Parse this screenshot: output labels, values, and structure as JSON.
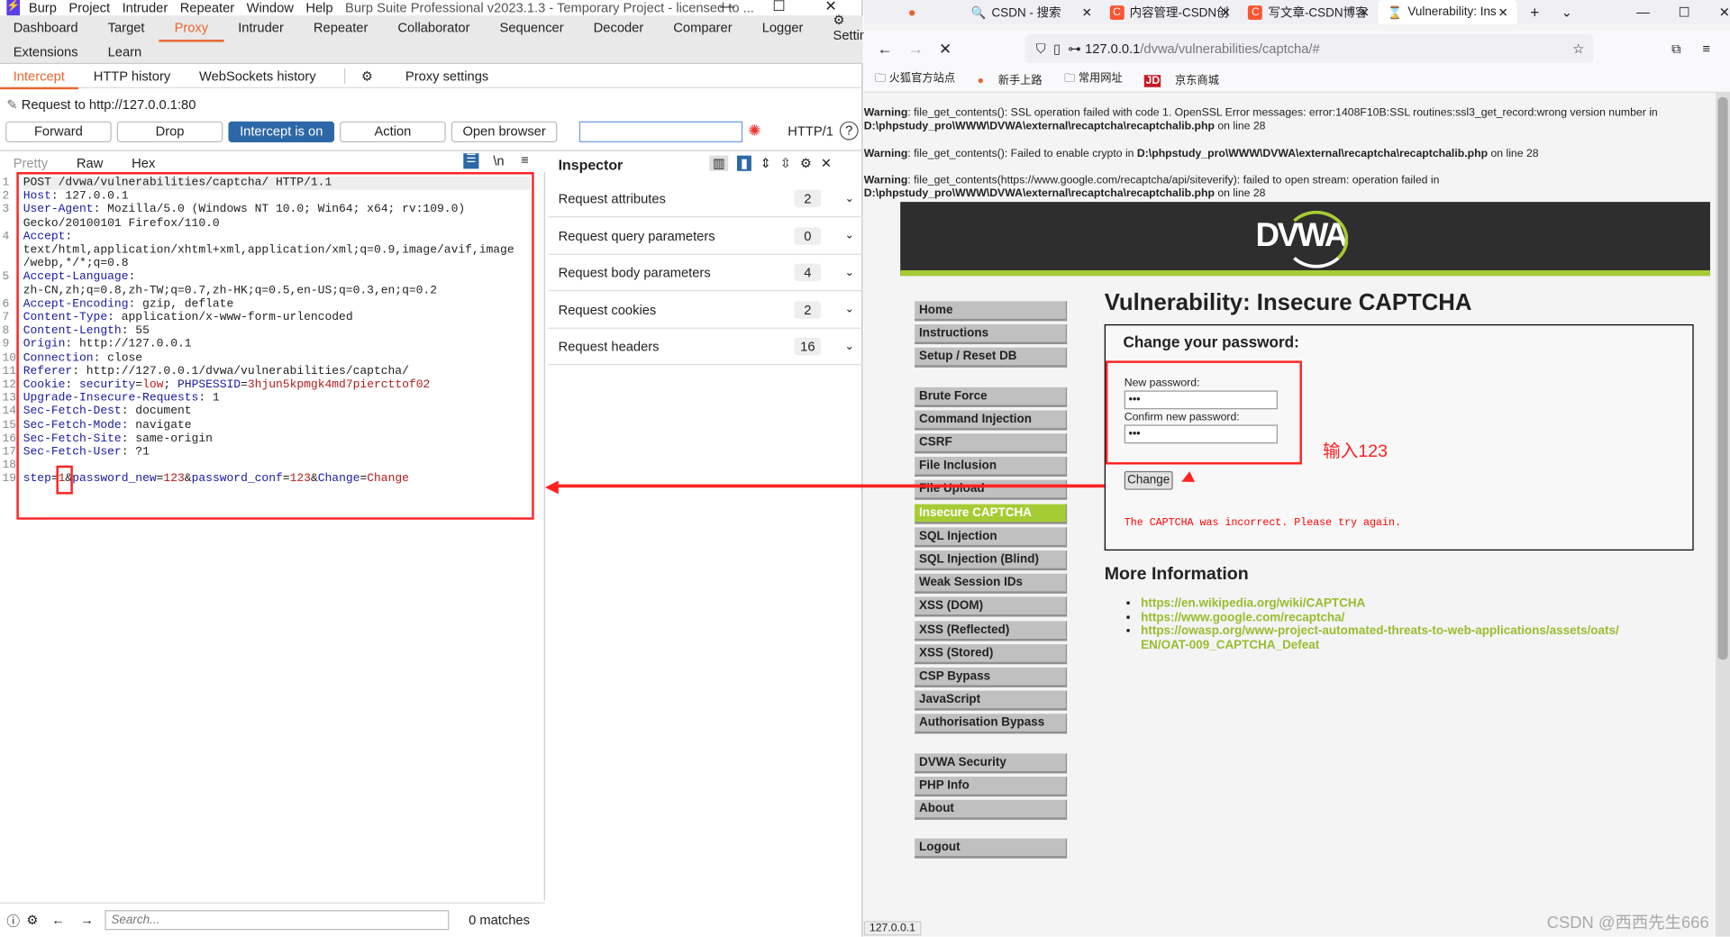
{
  "burp": {
    "menu": [
      "Burp",
      "Project",
      "Intruder",
      "Repeater",
      "Window",
      "Help"
    ],
    "title": "Burp Suite Professional v2023.1.3 - Temporary Project - licensed to ...",
    "tabs_row1": [
      "Dashboard",
      "Target",
      "Proxy",
      "Intruder",
      "Repeater",
      "Collaborator",
      "Sequencer",
      "Decoder",
      "Comparer",
      "Logger"
    ],
    "settings": "Settings",
    "tabs_row2": [
      "Extensions",
      "Learn"
    ],
    "active_tab": "Proxy",
    "proxy_tabs": [
      "Intercept",
      "HTTP history",
      "WebSockets history"
    ],
    "proxy_settings": "Proxy settings",
    "request_to": "Request to http://127.0.0.1:80",
    "buttons": {
      "forward": "Forward",
      "drop": "Drop",
      "intercept": "Intercept is on",
      "action": "Action",
      "open_browser": "Open browser"
    },
    "http_version": "HTTP/1",
    "editor_tabs": [
      "Pretty",
      "Raw",
      "Hex"
    ],
    "newline_toggle": "\\n",
    "request_lines": [
      {
        "n": "1",
        "segs": [
          [
            "v",
            "POST /dvwa/vulnerabilities/captcha/ HTTP/1.1"
          ]
        ]
      },
      {
        "n": "2",
        "segs": [
          [
            "k",
            "Host"
          ],
          [
            "v",
            ": 127.0.0.1"
          ]
        ]
      },
      {
        "n": "3",
        "segs": [
          [
            "k",
            "User-Agent"
          ],
          [
            "v",
            ": Mozilla/5.0 (Windows NT 10.0; Win64; x64; rv:109.0)"
          ]
        ]
      },
      {
        "n": "",
        "segs": [
          [
            "v",
            "Gecko/20100101 Firefox/110.0"
          ]
        ]
      },
      {
        "n": "4",
        "segs": [
          [
            "k",
            "Accept"
          ],
          [
            "v",
            ":"
          ]
        ]
      },
      {
        "n": "",
        "segs": [
          [
            "v",
            "text/html,application/xhtml+xml,application/xml;q=0.9,image/avif,image"
          ]
        ]
      },
      {
        "n": "",
        "segs": [
          [
            "v",
            "/webp,*/*;q=0.8"
          ]
        ]
      },
      {
        "n": "5",
        "segs": [
          [
            "k",
            "Accept-Language"
          ],
          [
            "v",
            ":"
          ]
        ]
      },
      {
        "n": "",
        "segs": [
          [
            "v",
            "zh-CN,zh;q=0.8,zh-TW;q=0.7,zh-HK;q=0.5,en-US;q=0.3,en;q=0.2"
          ]
        ]
      },
      {
        "n": "6",
        "segs": [
          [
            "k",
            "Accept-Encoding"
          ],
          [
            "v",
            ": gzip, deflate"
          ]
        ]
      },
      {
        "n": "7",
        "segs": [
          [
            "k",
            "Content-Type"
          ],
          [
            "v",
            ": application/x-www-form-urlencoded"
          ]
        ]
      },
      {
        "n": "8",
        "segs": [
          [
            "k",
            "Content-Length"
          ],
          [
            "v",
            ": 55"
          ]
        ]
      },
      {
        "n": "9",
        "segs": [
          [
            "k",
            "Origin"
          ],
          [
            "v",
            ": http://127.0.0.1"
          ]
        ]
      },
      {
        "n": "10",
        "segs": [
          [
            "k",
            "Connection"
          ],
          [
            "v",
            ": close"
          ]
        ]
      },
      {
        "n": "11",
        "segs": [
          [
            "k",
            "Referer"
          ],
          [
            "v",
            ": http://127.0.0.1/dvwa/vulnerabilities/captcha/"
          ]
        ]
      },
      {
        "n": "12",
        "segs": [
          [
            "k",
            "Cookie"
          ],
          [
            "v",
            ": "
          ],
          [
            "k",
            "security"
          ],
          [
            "v",
            "="
          ],
          [
            "r",
            "low"
          ],
          [
            "v",
            "; "
          ],
          [
            "k",
            "PHPSESSID"
          ],
          [
            "v",
            "="
          ],
          [
            "r",
            "3hjun5kpmgk4md7piercttof02"
          ]
        ]
      },
      {
        "n": "13",
        "segs": [
          [
            "k",
            "Upgrade-Insecure-Requests"
          ],
          [
            "v",
            ": 1"
          ]
        ]
      },
      {
        "n": "14",
        "segs": [
          [
            "k",
            "Sec-Fetch-Dest"
          ],
          [
            "v",
            ": document"
          ]
        ]
      },
      {
        "n": "15",
        "segs": [
          [
            "k",
            "Sec-Fetch-Mode"
          ],
          [
            "v",
            ": navigate"
          ]
        ]
      },
      {
        "n": "16",
        "segs": [
          [
            "k",
            "Sec-Fetch-Site"
          ],
          [
            "v",
            ": same-origin"
          ]
        ]
      },
      {
        "n": "17",
        "segs": [
          [
            "k",
            "Sec-Fetch-User"
          ],
          [
            "v",
            ": ?1"
          ]
        ]
      },
      {
        "n": "18",
        "segs": []
      },
      {
        "n": "19",
        "segs": [
          [
            "k",
            "step"
          ],
          [
            "v",
            "="
          ],
          [
            "r",
            "1"
          ],
          [
            "v",
            "&"
          ],
          [
            "k",
            "password_new"
          ],
          [
            "v",
            "="
          ],
          [
            "r",
            "123"
          ],
          [
            "v",
            "&"
          ],
          [
            "k",
            "password_conf"
          ],
          [
            "v",
            "="
          ],
          [
            "r",
            "123"
          ],
          [
            "v",
            "&"
          ],
          [
            "k",
            "Change"
          ],
          [
            "v",
            "="
          ],
          [
            "r",
            "Change"
          ]
        ]
      }
    ],
    "inspector": {
      "title": "Inspector",
      "rows": [
        {
          "label": "Request attributes",
          "count": "2"
        },
        {
          "label": "Request query parameters",
          "count": "0"
        },
        {
          "label": "Request body parameters",
          "count": "4"
        },
        {
          "label": "Request cookies",
          "count": "2"
        },
        {
          "label": "Request headers",
          "count": "16"
        }
      ]
    },
    "search_placeholder": "Search...",
    "matches": "0 matches"
  },
  "browser": {
    "tabs": [
      "CSDN - 搜索",
      "内容管理-CSDN创",
      "写文章-CSDN博客",
      "Vulnerability: Ins"
    ],
    "url_host": "127.0.0.1",
    "url_path": "/dvwa/vulnerabilities/captcha/#",
    "bookmarks": [
      "火狐官方站点",
      "新手上路",
      "常用网址",
      "京东商城"
    ],
    "warnings": [
      {
        "b": "Warning",
        "t": ": file_get_contents(): SSL operation failed with code 1. OpenSSL Error messages: error:1408F10B:SSL routines:ssl3_get_record:wrong version number in ",
        "p": "D:\\phpstudy_pro\\WWW\\DVWA\\external\\recaptcha\\recaptchalib.php",
        "e": " on line 28"
      },
      {
        "b": "Warning",
        "t": ": file_get_contents(): Failed to enable crypto in ",
        "p": "D:\\phpstudy_pro\\WWW\\DVWA\\external\\recaptcha\\recaptchalib.php",
        "e": " on line 28"
      },
      {
        "b": "Warning",
        "t": ": file_get_contents(https://www.google.com/recaptcha/api/siteverify): failed to open stream: operation failed in ",
        "p": "D:\\phpstudy_pro\\WWW\\DVWA\\external\\recaptcha\\recaptchalib.php",
        "e": " on line 28"
      }
    ],
    "logo": "DVWA",
    "menu_groups": [
      [
        "Home",
        "Instructions",
        "Setup / Reset DB"
      ],
      [
        "Brute Force",
        "Command Injection",
        "CSRF",
        "File Inclusion",
        "File Upload",
        "Insecure CAPTCHA",
        "SQL Injection",
        "SQL Injection (Blind)",
        "Weak Session IDs",
        "XSS (DOM)",
        "XSS (Reflected)",
        "XSS (Stored)",
        "CSP Bypass",
        "JavaScript",
        "Authorisation Bypass"
      ],
      [
        "DVWA Security",
        "PHP Info",
        "About"
      ],
      [
        "Logout"
      ]
    ],
    "selected_menu": "Insecure CAPTCHA",
    "page_title": "Vulnerability: Insecure CAPTCHA",
    "form_title": "Change your password:",
    "new_password_label": "New password:",
    "new_password_value": "•••",
    "confirm_label": "Confirm new password:",
    "confirm_value": "•••",
    "change_button": "Change",
    "error": "The CAPTCHA was incorrect. Please try again.",
    "more_info": "More Information",
    "links": [
      "https://en.wikipedia.org/wiki/CAPTCHA",
      "https://www.google.com/recaptcha/",
      "https://owasp.org/www-project-automated-threats-to-web-applications/assets/oats/EN/OAT-009_CAPTCHA_Defeat"
    ],
    "status": "127.0.0.1"
  },
  "annotation": {
    "text": "输入123",
    "color": "#ff2020"
  },
  "watermark": "CSDN @西西先生666",
  "colors": {
    "accent": "#e8662f",
    "intercept": "#2c68a8",
    "dvwa_green": "#a6cc33"
  }
}
